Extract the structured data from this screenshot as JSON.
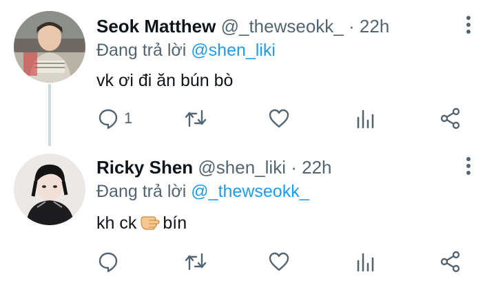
{
  "tweets": [
    {
      "name": "Seok Matthew",
      "handle": "@_thewseokk_",
      "separator": "·",
      "time": "22h",
      "replying_prefix": "Đang trả lời",
      "replying_to": "@shen_liki",
      "text": "vk ơi đi ăn bún bò",
      "reply_count": "1",
      "avatar": "profile-photo"
    },
    {
      "name": "Ricky Shen",
      "handle": "@shen_liki",
      "separator": "·",
      "time": "22h",
      "replying_prefix": "Đang trả lời",
      "replying_to": "@_thewseokk_",
      "text_before": "kh ck",
      "emoji": "pointing-hand-emoji",
      "text_after": "bín",
      "reply_count": "",
      "avatar": "profile-photo"
    }
  ],
  "icons": {
    "reply": "reply-icon",
    "retweet": "retweet-icon",
    "like": "heart-icon",
    "views": "views-icon",
    "share": "share-icon",
    "more": "more-options-icon"
  },
  "colors": {
    "text": "#0f1419",
    "secondary": "#536471",
    "link": "#1d9bf0",
    "thread_line": "#cfd9de"
  }
}
